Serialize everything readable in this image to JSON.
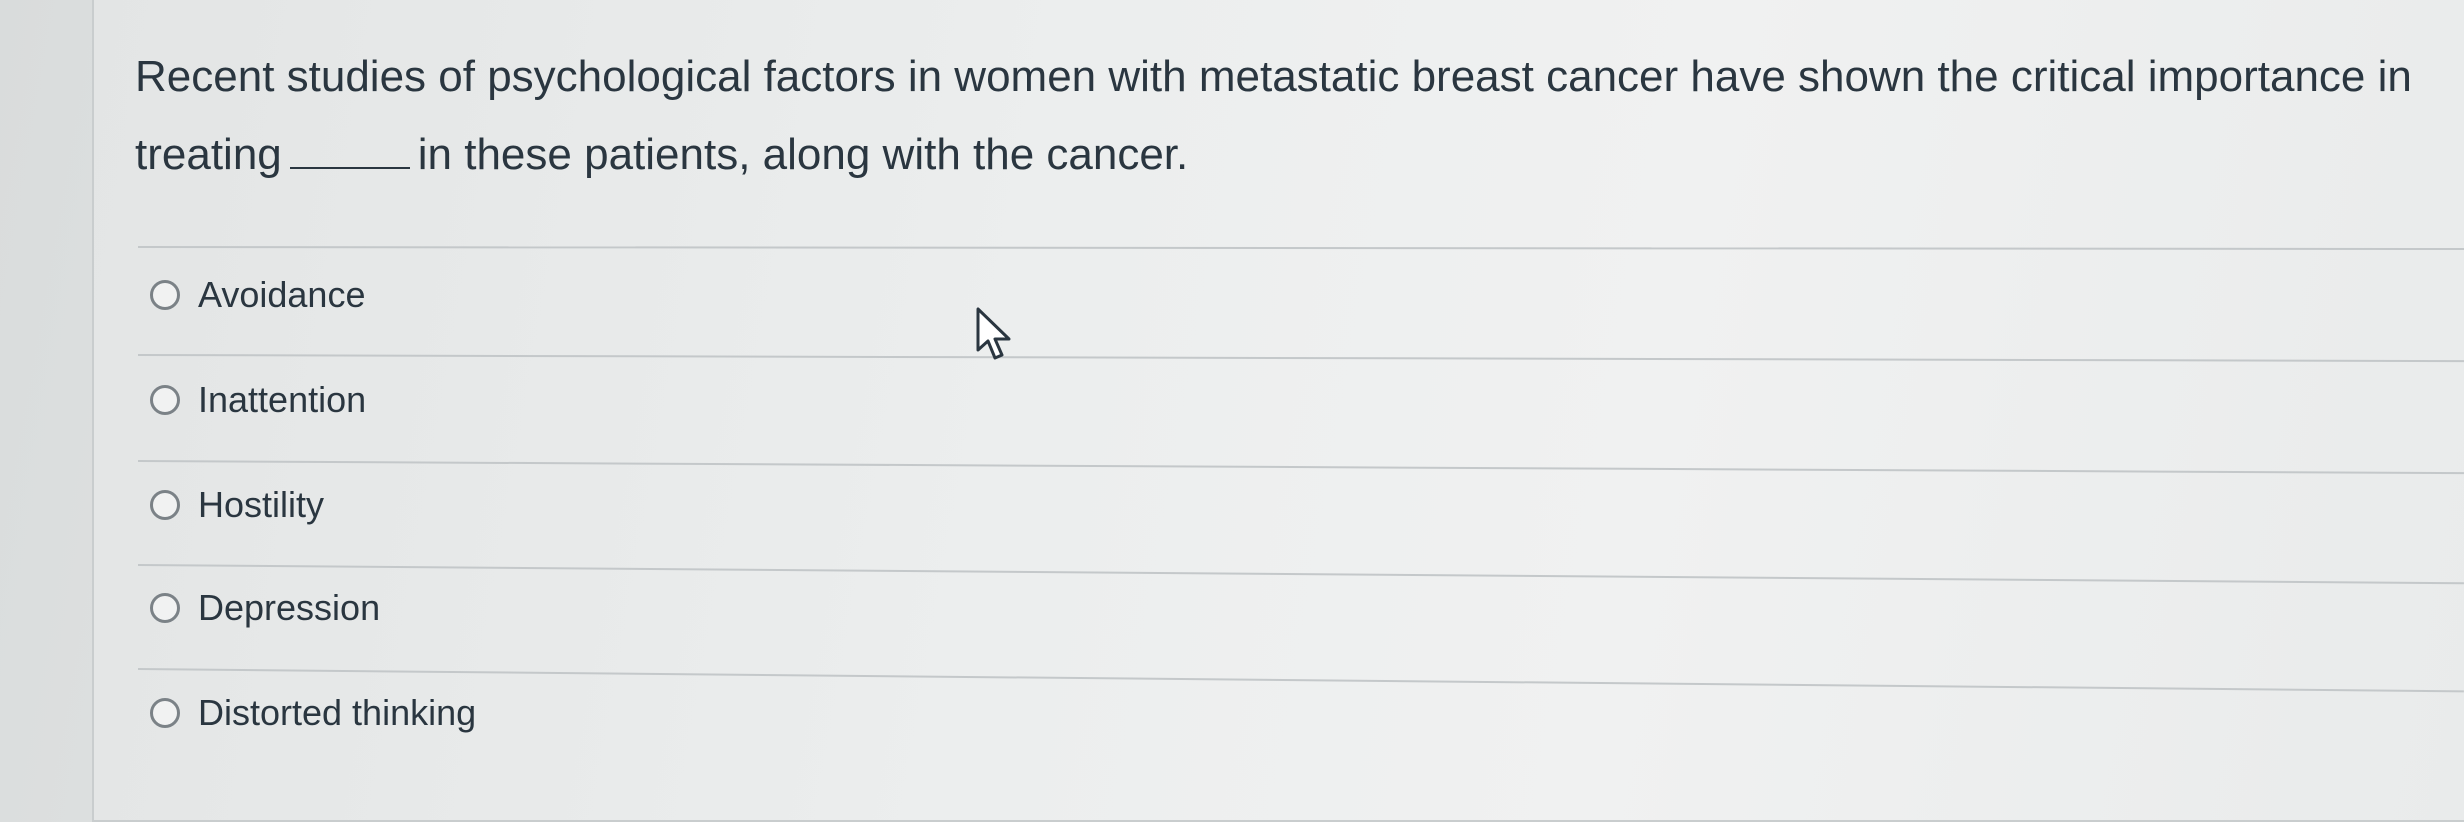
{
  "question": {
    "text_before": "Recent studies of psychological factors in women with metastatic breast cancer have shown the critical importance in treating",
    "text_after": "in these patients, along with the cancer."
  },
  "answers": [
    {
      "label": "Avoidance",
      "selected": false
    },
    {
      "label": "Inattention",
      "selected": false
    },
    {
      "label": "Hostility",
      "selected": false
    },
    {
      "label": "Depression",
      "selected": false
    },
    {
      "label": "Distorted thinking",
      "selected": false
    }
  ],
  "icons": {
    "cursor": "mouse-pointer-icon",
    "radio": "radio-button-icon"
  }
}
